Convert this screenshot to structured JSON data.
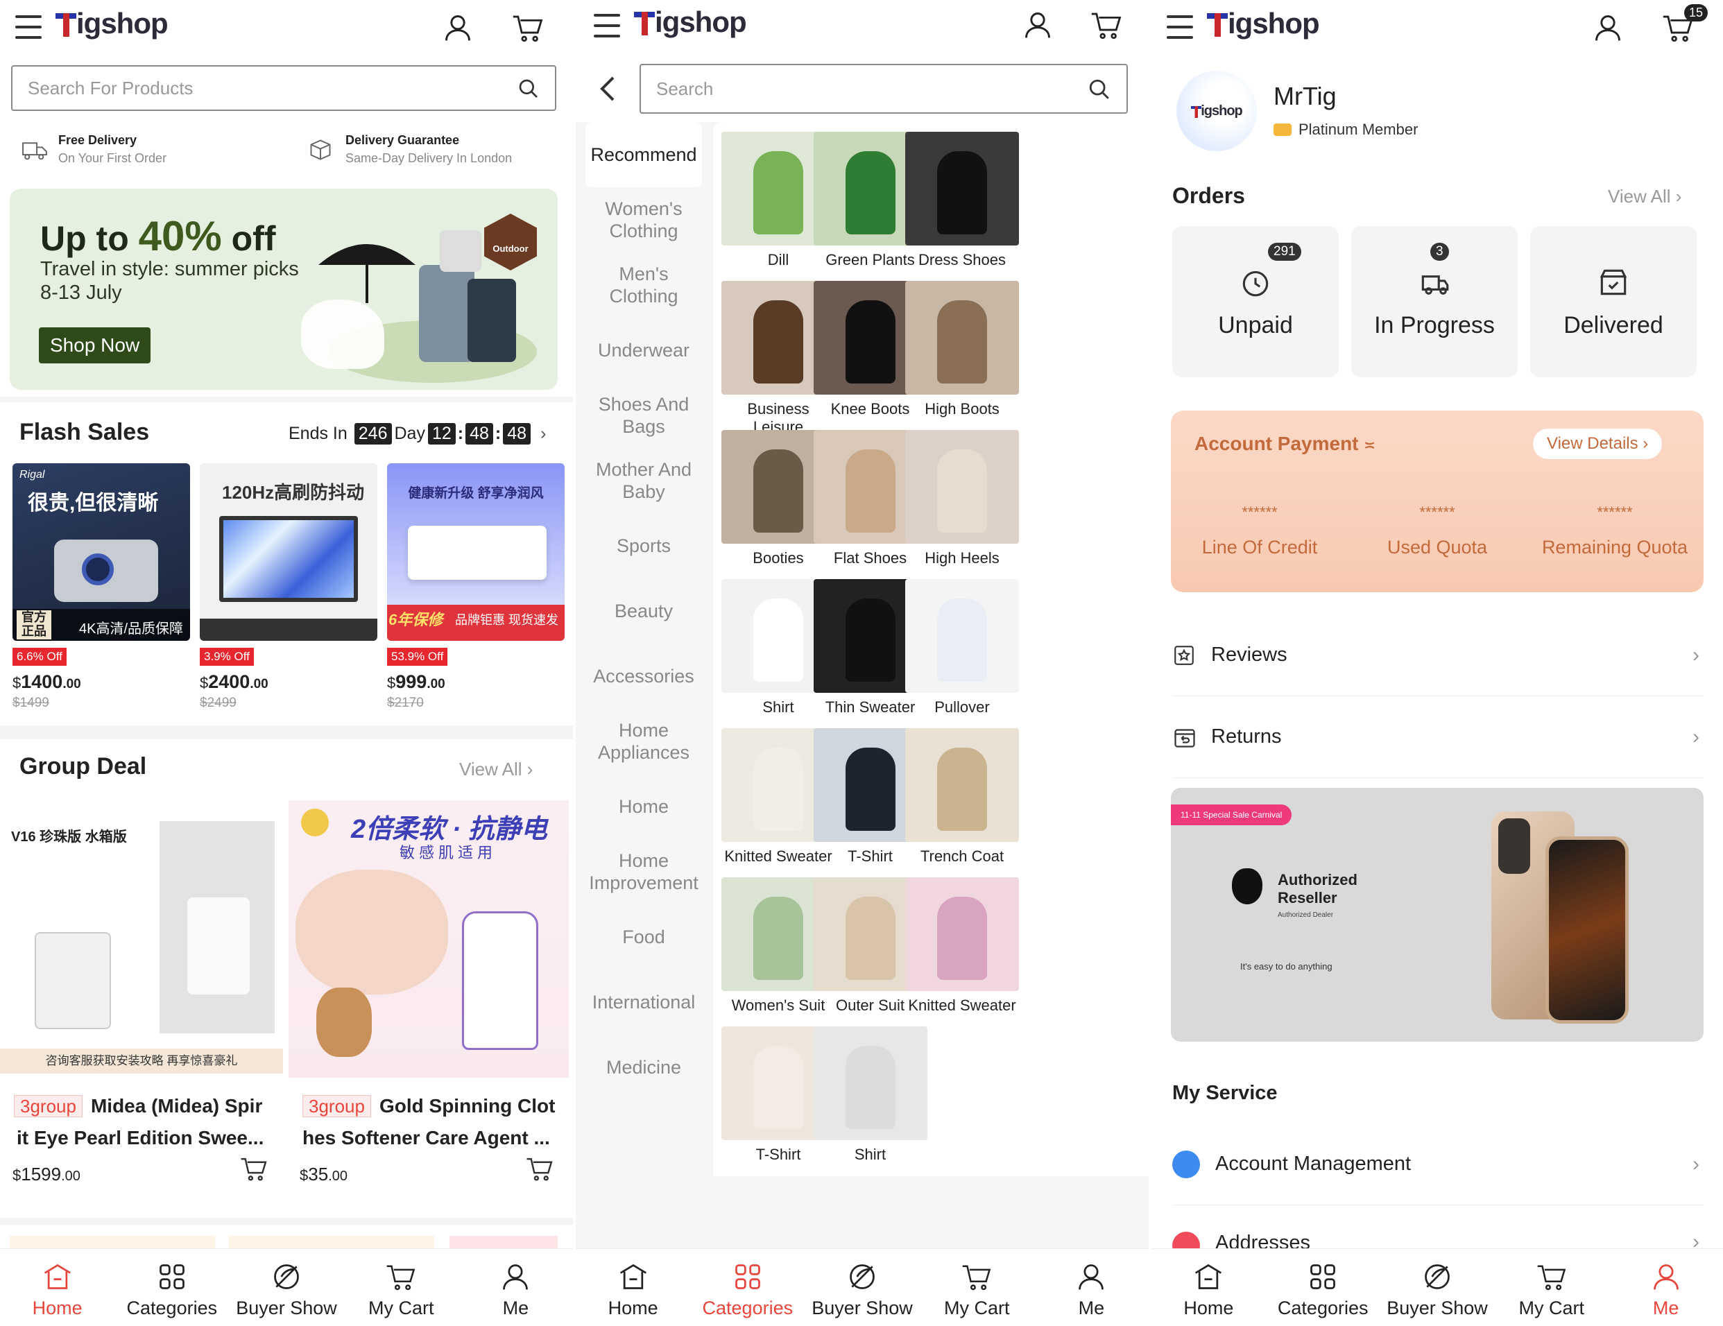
{
  "brand": {
    "name": "igshop",
    "accent": "#e8453c",
    "blue": "#2733a8"
  },
  "home": {
    "search_placeholder": "Search For Products",
    "free_delivery_title": "Free Delivery",
    "free_delivery_sub": "On Your First Order",
    "guarantee_title": "Delivery Guarantee",
    "guarantee_sub": "Same-Day Delivery In London",
    "banner": {
      "headline_pre": "Up to ",
      "headline_num": "40%",
      "headline_post": " off",
      "line1": "Travel in style: summer picks",
      "line2": "8-13 July",
      "cta": "Shop Now",
      "badge": "Outdoor"
    },
    "flash": {
      "title": "Flash Sales",
      "ends_in": "Ends In",
      "days": "246",
      "day_label": "Day",
      "h": "12",
      "m": "48",
      "s": "48",
      "items": [
        {
          "img_text1": "很贵,但很清晰",
          "img_text2": "官方正品",
          "img_text3": "4K高清/品质保障",
          "off": "6.6% Off",
          "price_int": "1400",
          "price_dec": ".00",
          "orig": "$1499"
        },
        {
          "img_text1": "120Hz高刷防抖动",
          "img_text2": "",
          "img_text3": "",
          "off": "3.9% Off",
          "price_int": "2400",
          "price_dec": ".00",
          "orig": "$2499"
        },
        {
          "img_text1": "健康新升级 舒享净润风",
          "img_text2": "6年保修",
          "img_text3": "品牌钜惠 现货速发",
          "off": "53.9% Off",
          "price_int": "999",
          "price_dec": ".00",
          "orig": "$2170"
        }
      ]
    },
    "group": {
      "title": "Group Deal",
      "view_all": "View All",
      "items": [
        {
          "tag": "3group",
          "name": "Midea (Midea) Spirit Eye Pearl Edition Swee...",
          "name_l1": "Midea (Midea) Spir",
          "name_l2": "it Eye Pearl Edition Swee...",
          "price": "1599",
          "dec": ".00",
          "img_title": "V16 珍珠版 水箱版",
          "img_foot": "咨询客服获取安装攻略 再享惊喜豪礼"
        },
        {
          "tag": "3group",
          "name_l1": "Gold Spinning Clot",
          "name_l2": "hes Softener Care Agent ...",
          "price": "35",
          "dec": ".00",
          "img_title": "2倍柔软 · 抗静电",
          "img_sub": "敏感肌适用"
        }
      ]
    }
  },
  "nav": {
    "home": "Home",
    "categories": "Categories",
    "buyer_show": "Buyer Show",
    "my_cart": "My Cart",
    "me": "Me"
  },
  "categories": {
    "search_placeholder": "Search",
    "side": [
      "Recommend",
      "Women's Clothing",
      "Men's Clothing",
      "Underwear",
      "Shoes And Bags",
      "Mother And Baby",
      "Sports",
      "Beauty",
      "Accessories",
      "Home Appliances",
      "Home",
      "Home Improvement",
      "Food",
      "International",
      "Medicine"
    ],
    "grid": [
      "Dill",
      "Green Plants",
      "Dress Shoes",
      "Business Leisure",
      "Knee Boots",
      "High Boots",
      "Booties",
      "Flat Shoes",
      "High Heels",
      "Shirt",
      "Thin Sweater",
      "Pullover",
      "Knitted Sweater",
      "T-Shirt",
      "Trench Coat",
      "Women's Suit",
      "Outer Suit",
      "Knitted Sweater",
      "T-Shirt",
      "Shirt"
    ]
  },
  "me": {
    "cart_count": "15",
    "user_name": "MrTig",
    "member": "Platinum Member",
    "avatar_logo": "igshop",
    "orders_title": "Orders",
    "orders_view_all": "View All",
    "orders": [
      {
        "label": "Unpaid",
        "count": "291"
      },
      {
        "label": "In Progress",
        "count": "3"
      },
      {
        "label": "Delivered",
        "count": ""
      }
    ],
    "payment": {
      "title": "Account Payment",
      "view": "View Details",
      "mask": "******",
      "cols": [
        "Line Of Credit",
        "Used Quota",
        "Remaining Quota"
      ]
    },
    "reviews": "Reviews",
    "returns": "Returns",
    "promo": {
      "tag": "11-11 Special Sale Carnival",
      "title1": "Authorized",
      "title2": "Reseller",
      "sub": "Authorized Dealer",
      "tagline": "It's easy to do anything"
    },
    "service_title": "My Service",
    "account_mgmt": "Account Management",
    "addresses": "Addresses"
  }
}
